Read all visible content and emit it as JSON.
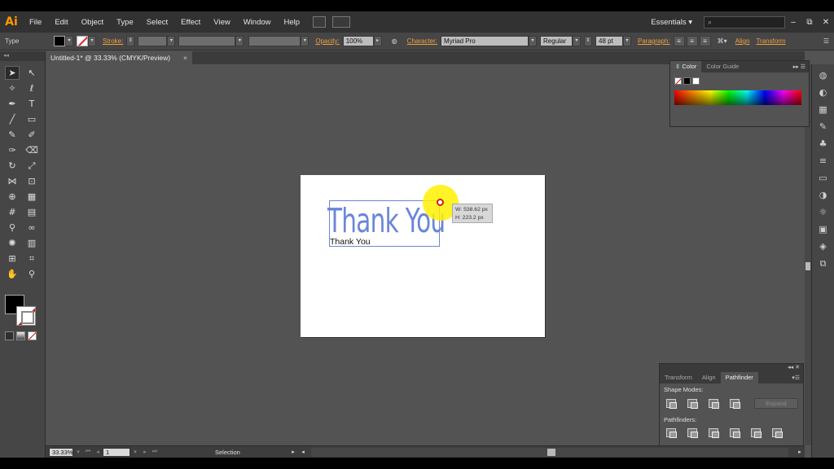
{
  "app": {
    "logo": "Ai"
  },
  "menu": {
    "items": [
      "File",
      "Edit",
      "Object",
      "Type",
      "Select",
      "Effect",
      "View",
      "Window",
      "Help"
    ],
    "workspace": "Essentials",
    "search_placeholder": "",
    "window_controls": [
      "–",
      "⧉",
      "✕"
    ]
  },
  "control_bar": {
    "selection_type": "Type",
    "stroke_label": "Stroke:",
    "opacity_label": "Opacity:",
    "opacity_value": "100%",
    "character_label": "Character:",
    "font_family": "Myriad Pro",
    "font_style": "Regular",
    "font_size": "48 pt",
    "paragraph_label": "Paragraph:",
    "align_label": "Align",
    "transform_label": "Transform"
  },
  "document": {
    "tab_title": "Untitled-1* @ 33.33% (CMYK/Preview)",
    "tab_close": "×",
    "headline": "Thank You",
    "subline": "Thank You",
    "size_width": "W: 538.62 px",
    "size_height": "H: 223.2 px"
  },
  "tools": {
    "icons": [
      "selection-tool",
      "direct-selection-tool",
      "magic-wand-tool",
      "lasso-tool",
      "pen-tool",
      "type-tool",
      "line-tool",
      "rectangle-tool",
      "paintbrush-tool",
      "pencil-tool",
      "blob-brush-tool",
      "eraser-tool",
      "rotate-tool",
      "scale-tool",
      "width-tool",
      "free-transform-tool",
      "shape-builder-tool",
      "perspective-grid-tool",
      "mesh-tool",
      "gradient-tool",
      "eyedropper-tool",
      "blend-tool",
      "symbol-sprayer-tool",
      "column-graph-tool",
      "artboard-tool",
      "slice-tool",
      "hand-tool",
      "zoom-tool"
    ],
    "glyphs": [
      "➤",
      "↖",
      "✧",
      "ℓ",
      "✒",
      "T",
      "╱",
      "▭",
      "✎",
      "✐",
      "✑",
      "⌫",
      "↻",
      "⤢",
      "⋈",
      "⊡",
      "⊕",
      "▦",
      "#",
      "▤",
      "⚲",
      "∞",
      "✺",
      "▥",
      "⊞",
      "⌗",
      "✋",
      "⚲"
    ]
  },
  "color_panel": {
    "tabs": [
      "Color",
      "Color Guide"
    ],
    "controls": "▸▸ ☰"
  },
  "pathfinder_panel": {
    "tabs": [
      "Transform",
      "Align",
      "Pathfinder"
    ],
    "shape_modes_label": "Shape Modes:",
    "pathfinders_label": "Pathfinders:",
    "expand_label": "Expand"
  },
  "status_bar": {
    "zoom": "33.33%",
    "artboard_number": "1",
    "tool_status": "Selection"
  },
  "colors": {
    "accent": "#f0a040",
    "selection": "#6b86d8",
    "highlight": "#fff000"
  }
}
